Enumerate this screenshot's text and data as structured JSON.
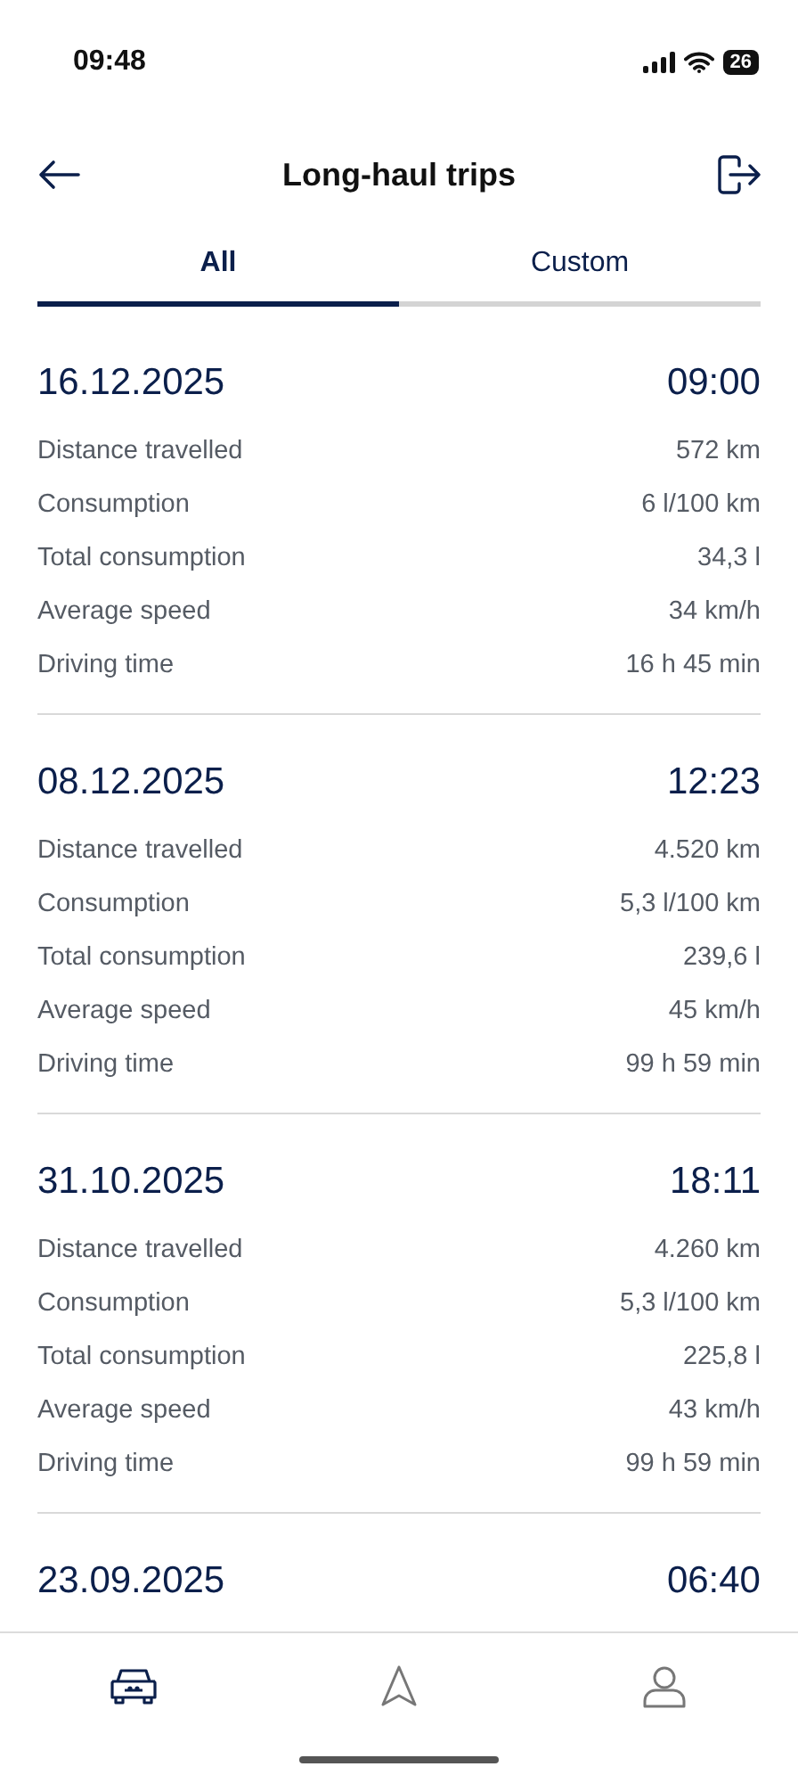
{
  "status_bar": {
    "time": "09:48",
    "battery": "26"
  },
  "header": {
    "title": "Long-haul trips"
  },
  "tabs": [
    {
      "label": "All",
      "selected": true
    },
    {
      "label": "Custom",
      "selected": false
    }
  ],
  "trips": [
    {
      "date": "16.12.2025",
      "time": "09:00",
      "stats": [
        {
          "label": "Distance travelled",
          "value": "572 km"
        },
        {
          "label": "Consumption",
          "value": "6 l/100 km"
        },
        {
          "label": "Total consumption",
          "value": "34,3 l"
        },
        {
          "label": "Average speed",
          "value": "34 km/h"
        },
        {
          "label": "Driving time",
          "value": "16 h 45 min"
        }
      ]
    },
    {
      "date": "08.12.2025",
      "time": "12:23",
      "stats": [
        {
          "label": "Distance travelled",
          "value": "4.520 km"
        },
        {
          "label": "Consumption",
          "value": "5,3 l/100 km"
        },
        {
          "label": "Total consumption",
          "value": "239,6 l"
        },
        {
          "label": "Average speed",
          "value": "45 km/h"
        },
        {
          "label": "Driving time",
          "value": "99 h 59 min"
        }
      ]
    },
    {
      "date": "31.10.2025",
      "time": "18:11",
      "stats": [
        {
          "label": "Distance travelled",
          "value": "4.260 km"
        },
        {
          "label": "Consumption",
          "value": "5,3 l/100 km"
        },
        {
          "label": "Total consumption",
          "value": "225,8 l"
        },
        {
          "label": "Average speed",
          "value": "43 km/h"
        },
        {
          "label": "Driving time",
          "value": "99 h 59 min"
        }
      ]
    },
    {
      "date": "23.09.2025",
      "time": "06:40"
    }
  ],
  "bottom_nav": [
    {
      "kind": "car",
      "selected": true
    },
    {
      "kind": "navigate",
      "selected": false
    },
    {
      "kind": "profile",
      "selected": false
    }
  ]
}
